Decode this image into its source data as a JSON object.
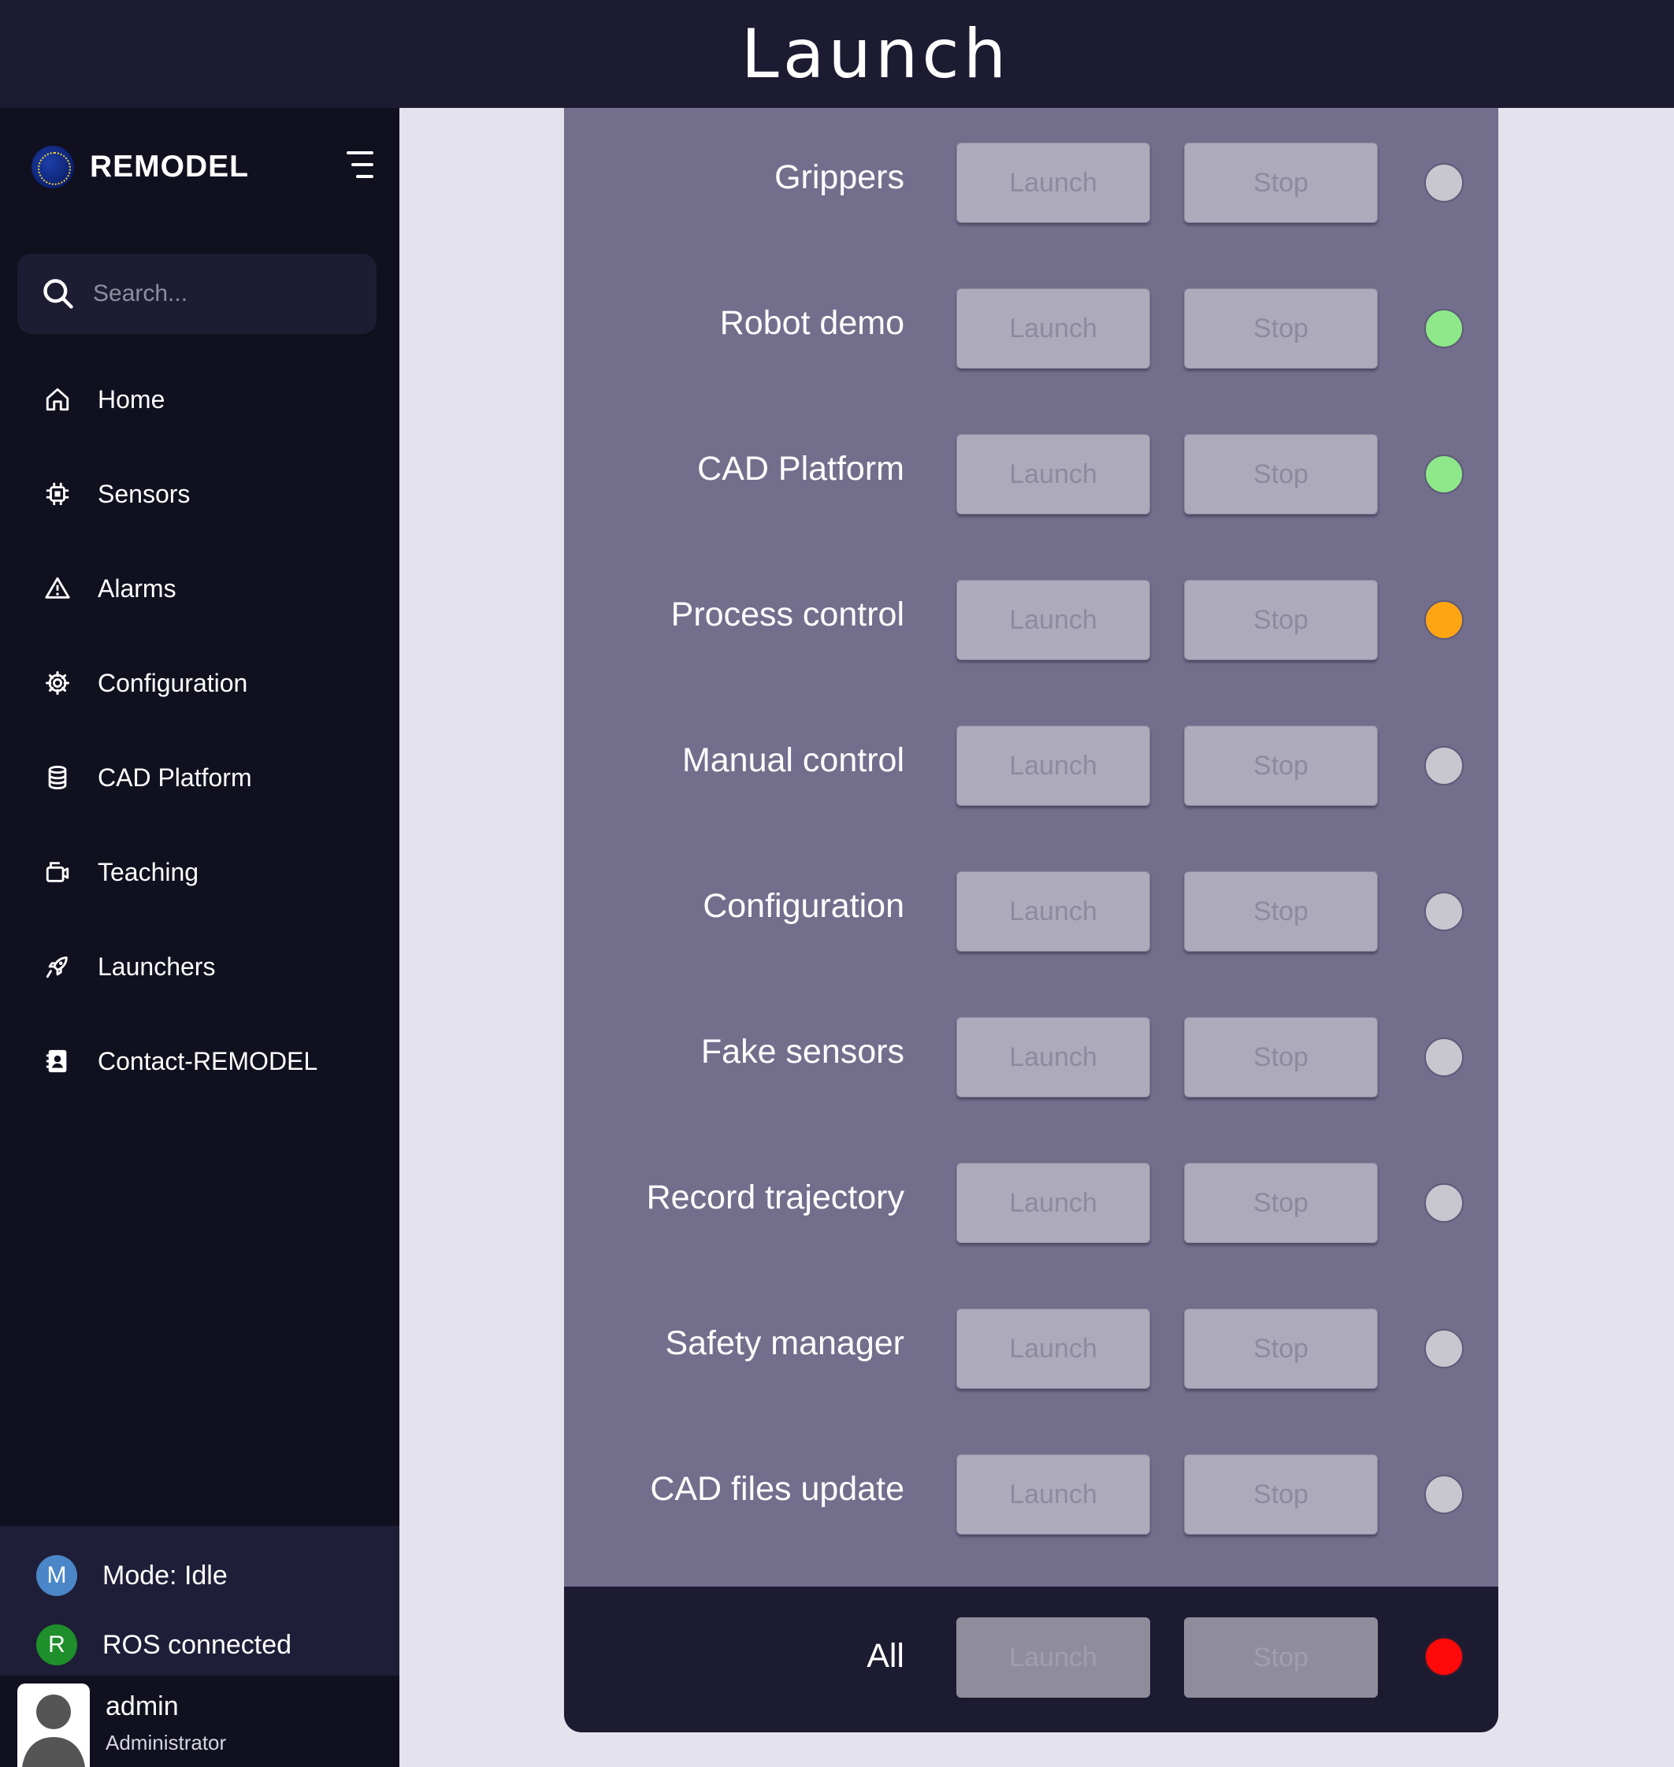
{
  "header": {
    "title": "Launch"
  },
  "brand": {
    "name": "REMODEL"
  },
  "search": {
    "placeholder": "Search..."
  },
  "sidebar": {
    "items": [
      {
        "label": "Home",
        "icon": "home-icon"
      },
      {
        "label": "Sensors",
        "icon": "chip-icon"
      },
      {
        "label": "Alarms",
        "icon": "warning-icon"
      },
      {
        "label": "Configuration",
        "icon": "gear-icon"
      },
      {
        "label": "CAD Platform",
        "icon": "database-icon"
      },
      {
        "label": "Teaching",
        "icon": "teaching-icon"
      },
      {
        "label": "Launchers",
        "icon": "rocket-icon"
      },
      {
        "label": "Contact-REMODEL",
        "icon": "contact-icon"
      }
    ]
  },
  "status": {
    "mode": {
      "badge": "M",
      "label": "Mode: Idle",
      "color": "#4a86c8"
    },
    "ros": {
      "badge": "R",
      "label": "ROS connected",
      "color": "#1e8f2a"
    }
  },
  "user": {
    "name": "admin",
    "role": "Administrator"
  },
  "launchers": [
    {
      "label": "Grippers",
      "launch": "Launch",
      "stop": "Stop",
      "status_color": "#c8c7cf"
    },
    {
      "label": "Robot demo",
      "launch": "Launch",
      "stop": "Stop",
      "status_color": "#8ee88a"
    },
    {
      "label": "CAD Platform",
      "launch": "Launch",
      "stop": "Stop",
      "status_color": "#8ee88a"
    },
    {
      "label": "Process control",
      "launch": "Launch",
      "stop": "Stop",
      "status_color": "#ffa514"
    },
    {
      "label": "Manual control",
      "launch": "Launch",
      "stop": "Stop",
      "status_color": "#c8c7cf"
    },
    {
      "label": "Configuration",
      "launch": "Launch",
      "stop": "Stop",
      "status_color": "#c8c7cf"
    },
    {
      "label": "Fake sensors",
      "launch": "Launch",
      "stop": "Stop",
      "status_color": "#c8c7cf"
    },
    {
      "label": "Record trajectory",
      "launch": "Launch",
      "stop": "Stop",
      "status_color": "#c8c7cf"
    },
    {
      "label": "Safety manager",
      "launch": "Launch",
      "stop": "Stop",
      "status_color": "#c8c7cf"
    },
    {
      "label": "CAD files update",
      "launch": "Launch",
      "stop": "Stop",
      "status_color": "#c8c7cf"
    }
  ],
  "all": {
    "label": "All",
    "launch": "Launch",
    "stop": "Stop",
    "status_color": "#ff0a0a"
  }
}
